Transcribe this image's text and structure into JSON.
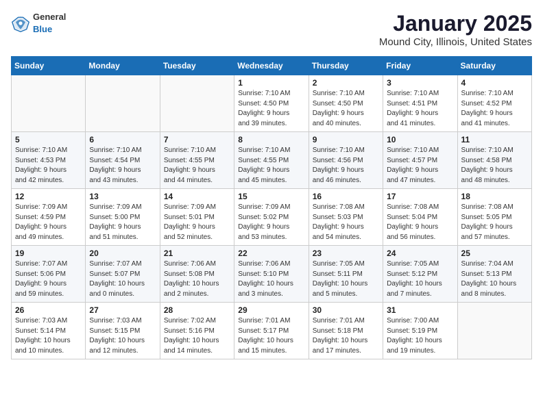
{
  "header": {
    "logo": {
      "general": "General",
      "blue": "Blue"
    },
    "title": "January 2025",
    "location": "Mound City, Illinois, United States"
  },
  "calendar": {
    "days_of_week": [
      "Sunday",
      "Monday",
      "Tuesday",
      "Wednesday",
      "Thursday",
      "Friday",
      "Saturday"
    ],
    "weeks": [
      [
        {
          "day": null,
          "info": null
        },
        {
          "day": null,
          "info": null
        },
        {
          "day": null,
          "info": null
        },
        {
          "day": "1",
          "info": "Sunrise: 7:10 AM\nSunset: 4:50 PM\nDaylight: 9 hours\nand 39 minutes."
        },
        {
          "day": "2",
          "info": "Sunrise: 7:10 AM\nSunset: 4:50 PM\nDaylight: 9 hours\nand 40 minutes."
        },
        {
          "day": "3",
          "info": "Sunrise: 7:10 AM\nSunset: 4:51 PM\nDaylight: 9 hours\nand 41 minutes."
        },
        {
          "day": "4",
          "info": "Sunrise: 7:10 AM\nSunset: 4:52 PM\nDaylight: 9 hours\nand 41 minutes."
        }
      ],
      [
        {
          "day": "5",
          "info": "Sunrise: 7:10 AM\nSunset: 4:53 PM\nDaylight: 9 hours\nand 42 minutes."
        },
        {
          "day": "6",
          "info": "Sunrise: 7:10 AM\nSunset: 4:54 PM\nDaylight: 9 hours\nand 43 minutes."
        },
        {
          "day": "7",
          "info": "Sunrise: 7:10 AM\nSunset: 4:55 PM\nDaylight: 9 hours\nand 44 minutes."
        },
        {
          "day": "8",
          "info": "Sunrise: 7:10 AM\nSunset: 4:55 PM\nDaylight: 9 hours\nand 45 minutes."
        },
        {
          "day": "9",
          "info": "Sunrise: 7:10 AM\nSunset: 4:56 PM\nDaylight: 9 hours\nand 46 minutes."
        },
        {
          "day": "10",
          "info": "Sunrise: 7:10 AM\nSunset: 4:57 PM\nDaylight: 9 hours\nand 47 minutes."
        },
        {
          "day": "11",
          "info": "Sunrise: 7:10 AM\nSunset: 4:58 PM\nDaylight: 9 hours\nand 48 minutes."
        }
      ],
      [
        {
          "day": "12",
          "info": "Sunrise: 7:09 AM\nSunset: 4:59 PM\nDaylight: 9 hours\nand 49 minutes."
        },
        {
          "day": "13",
          "info": "Sunrise: 7:09 AM\nSunset: 5:00 PM\nDaylight: 9 hours\nand 51 minutes."
        },
        {
          "day": "14",
          "info": "Sunrise: 7:09 AM\nSunset: 5:01 PM\nDaylight: 9 hours\nand 52 minutes."
        },
        {
          "day": "15",
          "info": "Sunrise: 7:09 AM\nSunset: 5:02 PM\nDaylight: 9 hours\nand 53 minutes."
        },
        {
          "day": "16",
          "info": "Sunrise: 7:08 AM\nSunset: 5:03 PM\nDaylight: 9 hours\nand 54 minutes."
        },
        {
          "day": "17",
          "info": "Sunrise: 7:08 AM\nSunset: 5:04 PM\nDaylight: 9 hours\nand 56 minutes."
        },
        {
          "day": "18",
          "info": "Sunrise: 7:08 AM\nSunset: 5:05 PM\nDaylight: 9 hours\nand 57 minutes."
        }
      ],
      [
        {
          "day": "19",
          "info": "Sunrise: 7:07 AM\nSunset: 5:06 PM\nDaylight: 9 hours\nand 59 minutes."
        },
        {
          "day": "20",
          "info": "Sunrise: 7:07 AM\nSunset: 5:07 PM\nDaylight: 10 hours\nand 0 minutes."
        },
        {
          "day": "21",
          "info": "Sunrise: 7:06 AM\nSunset: 5:08 PM\nDaylight: 10 hours\nand 2 minutes."
        },
        {
          "day": "22",
          "info": "Sunrise: 7:06 AM\nSunset: 5:10 PM\nDaylight: 10 hours\nand 3 minutes."
        },
        {
          "day": "23",
          "info": "Sunrise: 7:05 AM\nSunset: 5:11 PM\nDaylight: 10 hours\nand 5 minutes."
        },
        {
          "day": "24",
          "info": "Sunrise: 7:05 AM\nSunset: 5:12 PM\nDaylight: 10 hours\nand 7 minutes."
        },
        {
          "day": "25",
          "info": "Sunrise: 7:04 AM\nSunset: 5:13 PM\nDaylight: 10 hours\nand 8 minutes."
        }
      ],
      [
        {
          "day": "26",
          "info": "Sunrise: 7:03 AM\nSunset: 5:14 PM\nDaylight: 10 hours\nand 10 minutes."
        },
        {
          "day": "27",
          "info": "Sunrise: 7:03 AM\nSunset: 5:15 PM\nDaylight: 10 hours\nand 12 minutes."
        },
        {
          "day": "28",
          "info": "Sunrise: 7:02 AM\nSunset: 5:16 PM\nDaylight: 10 hours\nand 14 minutes."
        },
        {
          "day": "29",
          "info": "Sunrise: 7:01 AM\nSunset: 5:17 PM\nDaylight: 10 hours\nand 15 minutes."
        },
        {
          "day": "30",
          "info": "Sunrise: 7:01 AM\nSunset: 5:18 PM\nDaylight: 10 hours\nand 17 minutes."
        },
        {
          "day": "31",
          "info": "Sunrise: 7:00 AM\nSunset: 5:19 PM\nDaylight: 10 hours\nand 19 minutes."
        },
        {
          "day": null,
          "info": null
        }
      ]
    ]
  }
}
